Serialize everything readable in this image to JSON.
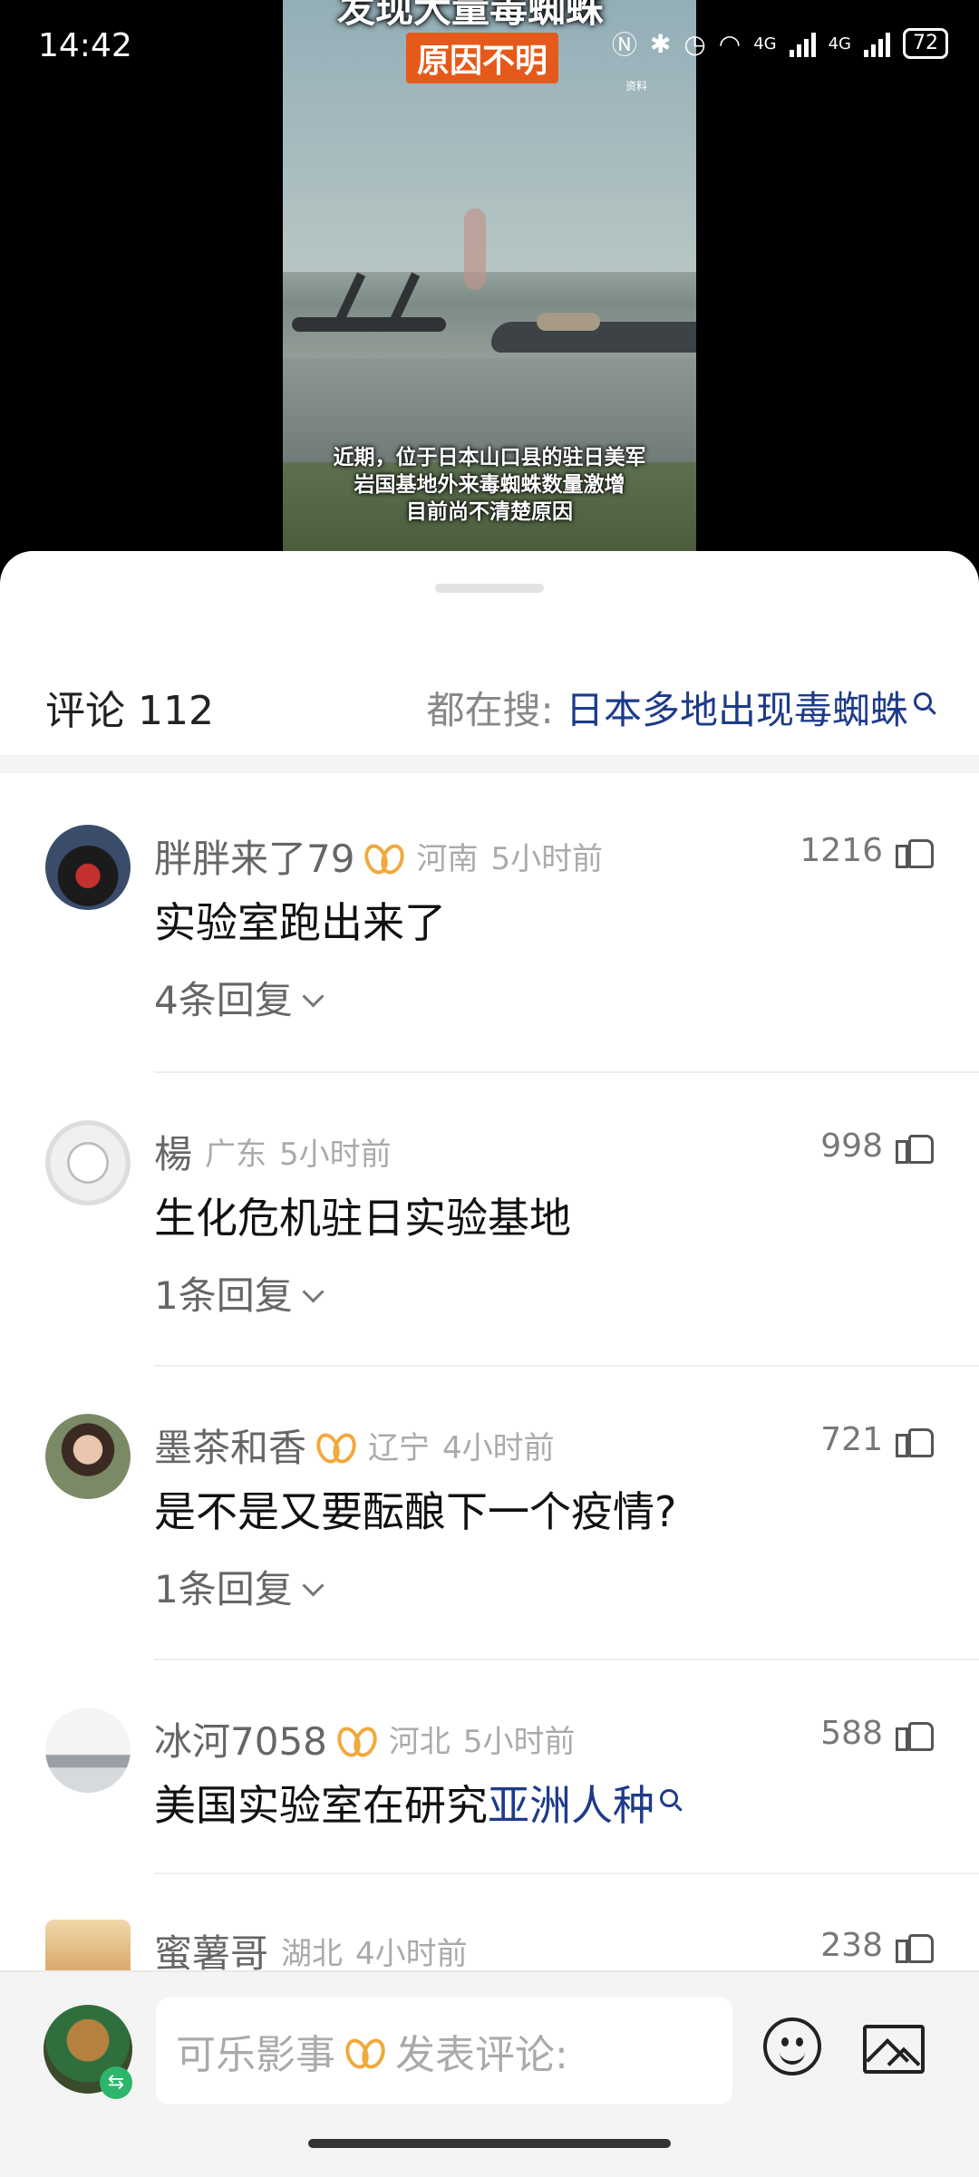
{
  "status_bar": {
    "time": "14:42",
    "network": "4G",
    "network2": "4G",
    "battery": "72"
  },
  "video": {
    "title": "发现大量毒蜘蛛",
    "tag": "原因不明",
    "source": "资料",
    "caption_lines": [
      "近期，位于日本山口县的驻日美军",
      "岩国基地外来毒蜘蛛数量激增",
      "目前尚不清楚原因"
    ]
  },
  "comments_header": {
    "count_label": "评论 112",
    "search_prefix": "都在搜: ",
    "search_keyword": "日本多地出现毒蜘蛛"
  },
  "comments": [
    {
      "username": "胖胖来了79",
      "vip": true,
      "location": "河南",
      "time": "5小时前",
      "likes": "1216",
      "text": "实验室跑出来了",
      "replies": "4条回复"
    },
    {
      "username": "楊",
      "vip": false,
      "location": "广东",
      "time": "5小时前",
      "likes": "998",
      "text": "生化危机驻日实验基地",
      "replies": "1条回复"
    },
    {
      "username": "墨茶和香",
      "vip": true,
      "location": "辽宁",
      "time": "4小时前",
      "likes": "721",
      "text": "是不是又要酝酿下一个疫情?",
      "replies": "1条回复"
    },
    {
      "username": "冰河7058",
      "vip": true,
      "location": "河北",
      "time": "5小时前",
      "likes": "588",
      "text_plain": "美国实验室在研究",
      "text_link": "亚洲人种"
    },
    {
      "username": "蜜薯哥",
      "vip": false,
      "location": "湖北",
      "time": "4小时前",
      "likes": "238"
    }
  ],
  "footer": {
    "username": "可乐影事",
    "placeholder": "发表评论:"
  },
  "colors": {
    "link": "#1d3b8a",
    "vip": "#f0a93c",
    "video_tag": "#e55a1a"
  },
  "icons": [
    "search-icon",
    "thumb-up-icon",
    "chevron-down-icon",
    "vip-icon",
    "emoji-icon",
    "image-icon",
    "wifi-icon",
    "bluetooth-icon",
    "alarm-icon"
  ]
}
